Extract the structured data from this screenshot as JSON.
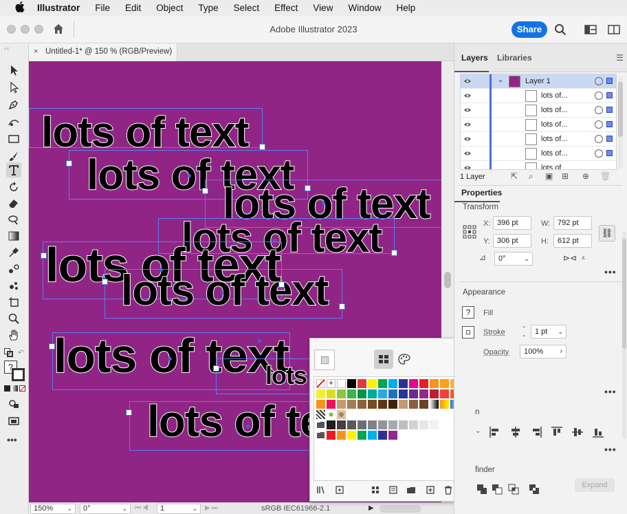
{
  "menubar": {
    "items": [
      "Illustrator",
      "File",
      "Edit",
      "Object",
      "Type",
      "Select",
      "Effect",
      "View",
      "Window",
      "Help"
    ]
  },
  "titlebar": {
    "title": "Adobe Illustrator 2023",
    "share_label": "Share"
  },
  "document": {
    "tab_label": "Untitled-1* @ 150 % (RGB/Preview)",
    "close_glyph": "×",
    "canvas_color": "#912586",
    "text_objects": [
      "lots of text",
      "lots of text",
      "lots of text",
      "lots of text",
      "lots of text",
      "lots of text",
      "lots of text",
      "lots",
      "lots of te"
    ]
  },
  "statusbar": {
    "zoom": "150%",
    "rotation": "0°",
    "artboard": "1",
    "color_profile": "sRGB IEC61966-2.1"
  },
  "layers_panel": {
    "tabs": [
      "Layers",
      "Libraries"
    ],
    "layer_name": "Layer 1",
    "items": [
      "lots of...",
      "lots of...",
      "lots of...",
      "lots of...",
      "lots of...",
      "lots of"
    ],
    "footer_count": "1 Layer"
  },
  "properties": {
    "title": "Properties",
    "transform_title": "Transform",
    "x_label": "X:",
    "x_value": "396 pt",
    "y_label": "Y:",
    "y_value": "306 pt",
    "w_label": "W:",
    "w_value": "792 pt",
    "h_label": "H:",
    "h_value": "612 pt",
    "angle_value": "0°",
    "appearance_title": "Appearance",
    "fill_label": "Fill",
    "fill_glyph": "?",
    "stroke_label": "Stroke",
    "stroke_value": "1 pt",
    "opacity_label": "Opacity",
    "opacity_value": "100%",
    "align_partial": "n",
    "pathfinder_partial": "finder",
    "expand_label": "Expand"
  },
  "swatches": {
    "accent": "#1473e6"
  }
}
